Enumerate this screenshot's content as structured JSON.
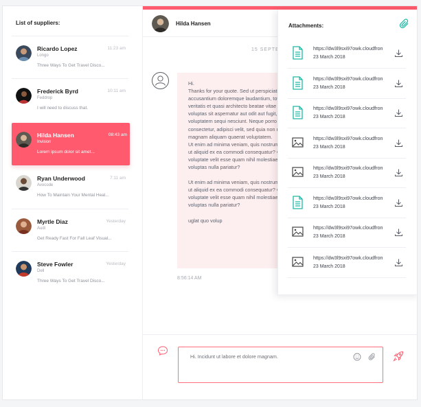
{
  "sidebar": {
    "title": "List of suppliers:",
    "contacts": [
      {
        "name": "Ricardo Lopez",
        "time": "11:23 am",
        "company": "Longo",
        "preview": "Three Ways To Get Travel Disco..."
      },
      {
        "name": "Frederick Byrd",
        "time": "10:11 am",
        "company": "Feddrop",
        "preview": "I will need to discuss that."
      },
      {
        "name": "Hilda Hansen",
        "time": "08:43 am",
        "company": "Invision",
        "preview": "Lorem ipsum dolor sit amet..."
      },
      {
        "name": "Ryan Underwood",
        "time": "7:11 am",
        "company": "Avocode",
        "preview": "How To Maintain Your Mental Heal..."
      },
      {
        "name": "Myrtle Diaz",
        "time": "Yesterday",
        "company": "Audi",
        "preview": "Get Ready Fast For Fall Leaf Visual..."
      },
      {
        "name": "Steve Fowler",
        "time": "Yesterday",
        "company": "Dell",
        "preview": "Three Ways To Get Travel Disco..."
      }
    ]
  },
  "chat": {
    "header_name": "Hilda Hansen",
    "date_divider": "15 SEPTE",
    "message_paragraphs": [
      "Hi.\nThanks for your quote. Sed ut perspiciatis unde omnis iste natus error sit voluptatem accusantium doloremque laudantium, totam rem aperiam, eaque ipsa quae ab illo inventore veritatis et quasi architecto beatae vitae dicta sunt explicabo. Nemo enim ipsam voluptatem quia voluptas sit aspernatur aut odit aut fugit, sed quia consequuntur magni dolores eos qui ratione voluptatem sequi nesciunt. Neque porro quisquam est, qui dolorem ipsum quia dolor sit amet, consectetur, adipisci velit, sed quia non numquam eius modi tempora incidunt ut labore et dolore magnam aliquam quaerat voluptatem.\nUt enim ad minima veniam, quis nostrum exercitationem ullam corporis suscipit laboriosam, nisi ut aliquid ex ea commodi consequatur? Quis autem vel eum iure reprehenderit qui in ea voluptate velit esse quam nihil molestiae consequatur, vel illum qui dolorem eum fugiat quo voluptas nulla pariatur?",
      "Ut enim ad minima veniam, quis nostrum exercitationem ullam corporis suscipit laboriosam, nisi ut aliquid ex ea commodi consequatur? Quis autem vel eum iure reprehenderit qui in ea voluptate velit esse quam nihil molestiae consequatur, vel illum qui dolorem eum fugiat quo voluptas nulla pariatur?",
      "uglat quo volup"
    ],
    "message_time": "8:56:14 AM",
    "composer_text": "Hi. Incidunt ut labore et dolore magnam."
  },
  "attachments": {
    "title": "Attachments:",
    "items": [
      {
        "kind": "doc-icon",
        "url": "https://dw3l9sxi97owk.cloudfron",
        "date": "23 March 2018"
      },
      {
        "kind": "doc-icon",
        "url": "https://dw3l9sxi97owk.cloudfron",
        "date": "23 March 2018"
      },
      {
        "kind": "doc-icon",
        "url": "https://dw3l9sxi97owk.cloudfron",
        "date": "23 March 2018"
      },
      {
        "kind": "image-icon",
        "url": "https://dw3l9sxi97owk.cloudfron",
        "date": "23 March 2018"
      },
      {
        "kind": "image-icon",
        "url": "https://dw3l9sxi97owk.cloudfron",
        "date": "23 March 2018"
      },
      {
        "kind": "doc-icon",
        "url": "https://dw3l9sxi97owk.cloudfron",
        "date": "23 March 2018"
      },
      {
        "kind": "image-icon",
        "url": "https://dw3l9sxi97owk.cloudfron",
        "date": "23 March 2018"
      },
      {
        "kind": "image-icon",
        "url": "https://dw3l9sxi97owk.cloudfron",
        "date": "23 March 2018"
      }
    ]
  },
  "colors": {
    "accent": "#ff5a6e",
    "teal": "#1fb8a8",
    "bubble": "#fdeef0"
  }
}
